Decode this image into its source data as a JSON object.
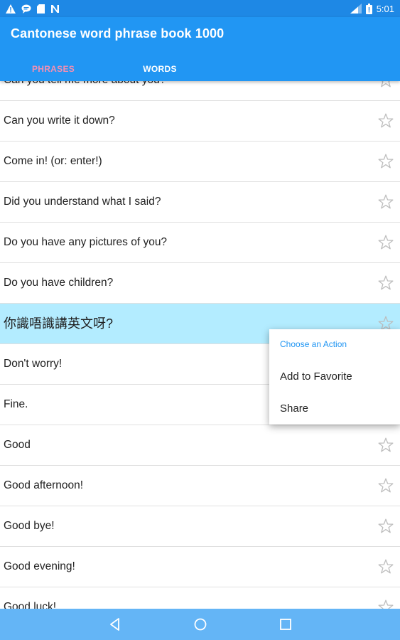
{
  "status_bar": {
    "time": "5:01",
    "left_icons": [
      "warning-icon",
      "chat-icon",
      "sd-card-icon",
      "n-notification-icon"
    ],
    "right_icons": [
      "signal-icon",
      "battery-icon"
    ]
  },
  "app_bar": {
    "title": "Cantonese word phrase book 1000",
    "color": "#2196f3"
  },
  "tabs": [
    {
      "label": "PHRASES",
      "active": true
    },
    {
      "label": "WORDS",
      "active": false
    }
  ],
  "phrases": [
    {
      "text": "Can you tell me more about you?"
    },
    {
      "text": "Can you write it down?"
    },
    {
      "text": "Come in! (or: enter!)"
    },
    {
      "text": "Did you understand what I said?"
    },
    {
      "text": "Do you have any pictures of you?"
    },
    {
      "text": "Do you have children?"
    },
    {
      "text": "你識唔識講英文呀?",
      "highlighted": true
    },
    {
      "text": "Don't worry!"
    },
    {
      "text": "Fine."
    },
    {
      "text": "Good"
    },
    {
      "text": "Good afternoon!"
    },
    {
      "text": "Good bye!"
    },
    {
      "text": "Good evening!"
    },
    {
      "text": "Good luck!"
    }
  ],
  "context_menu": {
    "title": "Choose an Action",
    "items": [
      "Add to Favorite",
      "Share"
    ]
  },
  "nav_bar": {
    "buttons": [
      "back-icon",
      "home-icon",
      "recents-icon"
    ]
  }
}
